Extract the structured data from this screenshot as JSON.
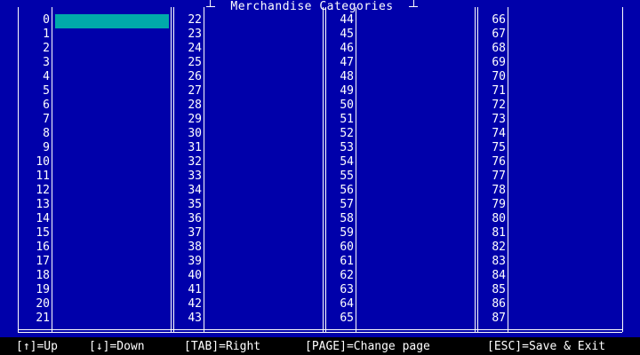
{
  "title": "Merchandise Categories",
  "colors": {
    "background": "#0000aa",
    "text": "#ffffff",
    "selection": "#00aaaa",
    "status_bg": "#000000"
  },
  "selected_index": 0,
  "columns": [
    {
      "numbers": [
        "0",
        "1",
        "2",
        "3",
        "4",
        "5",
        "6",
        "7",
        "8",
        "9",
        "10",
        "11",
        "12",
        "13",
        "14",
        "15",
        "16",
        "17",
        "18",
        "19",
        "20",
        "21"
      ],
      "entries": [
        "",
        "",
        "",
        "",
        "",
        "",
        "",
        "",
        "",
        "",
        "",
        "",
        "",
        "",
        "",
        "",
        "",
        "",
        "",
        "",
        "",
        ""
      ]
    },
    {
      "numbers": [
        "22",
        "23",
        "24",
        "25",
        "26",
        "27",
        "28",
        "29",
        "30",
        "31",
        "32",
        "33",
        "34",
        "35",
        "36",
        "37",
        "38",
        "39",
        "40",
        "41",
        "42",
        "43"
      ],
      "entries": [
        "",
        "",
        "",
        "",
        "",
        "",
        "",
        "",
        "",
        "",
        "",
        "",
        "",
        "",
        "",
        "",
        "",
        "",
        "",
        "",
        "",
        ""
      ]
    },
    {
      "numbers": [
        "44",
        "45",
        "46",
        "47",
        "48",
        "49",
        "50",
        "51",
        "52",
        "53",
        "54",
        "55",
        "56",
        "57",
        "58",
        "59",
        "60",
        "61",
        "62",
        "63",
        "64",
        "65"
      ],
      "entries": [
        "",
        "",
        "",
        "",
        "",
        "",
        "",
        "",
        "",
        "",
        "",
        "",
        "",
        "",
        "",
        "",
        "",
        "",
        "",
        "",
        "",
        ""
      ]
    },
    {
      "numbers": [
        "66",
        "67",
        "68",
        "69",
        "70",
        "71",
        "72",
        "73",
        "74",
        "75",
        "76",
        "77",
        "78",
        "79",
        "80",
        "81",
        "82",
        "83",
        "84",
        "85",
        "86",
        "87"
      ],
      "entries": [
        "",
        "",
        "",
        "",
        "",
        "",
        "",
        "",
        "",
        "",
        "",
        "",
        "",
        "",
        "",
        "",
        "",
        "",
        "",
        "",
        "",
        ""
      ]
    }
  ],
  "status": {
    "up": "[↑]=Up",
    "down": "[↓]=Down",
    "tab": "[TAB]=Right",
    "page": "[PAGE]=Change page",
    "esc": "[ESC]=Save & Exit"
  }
}
